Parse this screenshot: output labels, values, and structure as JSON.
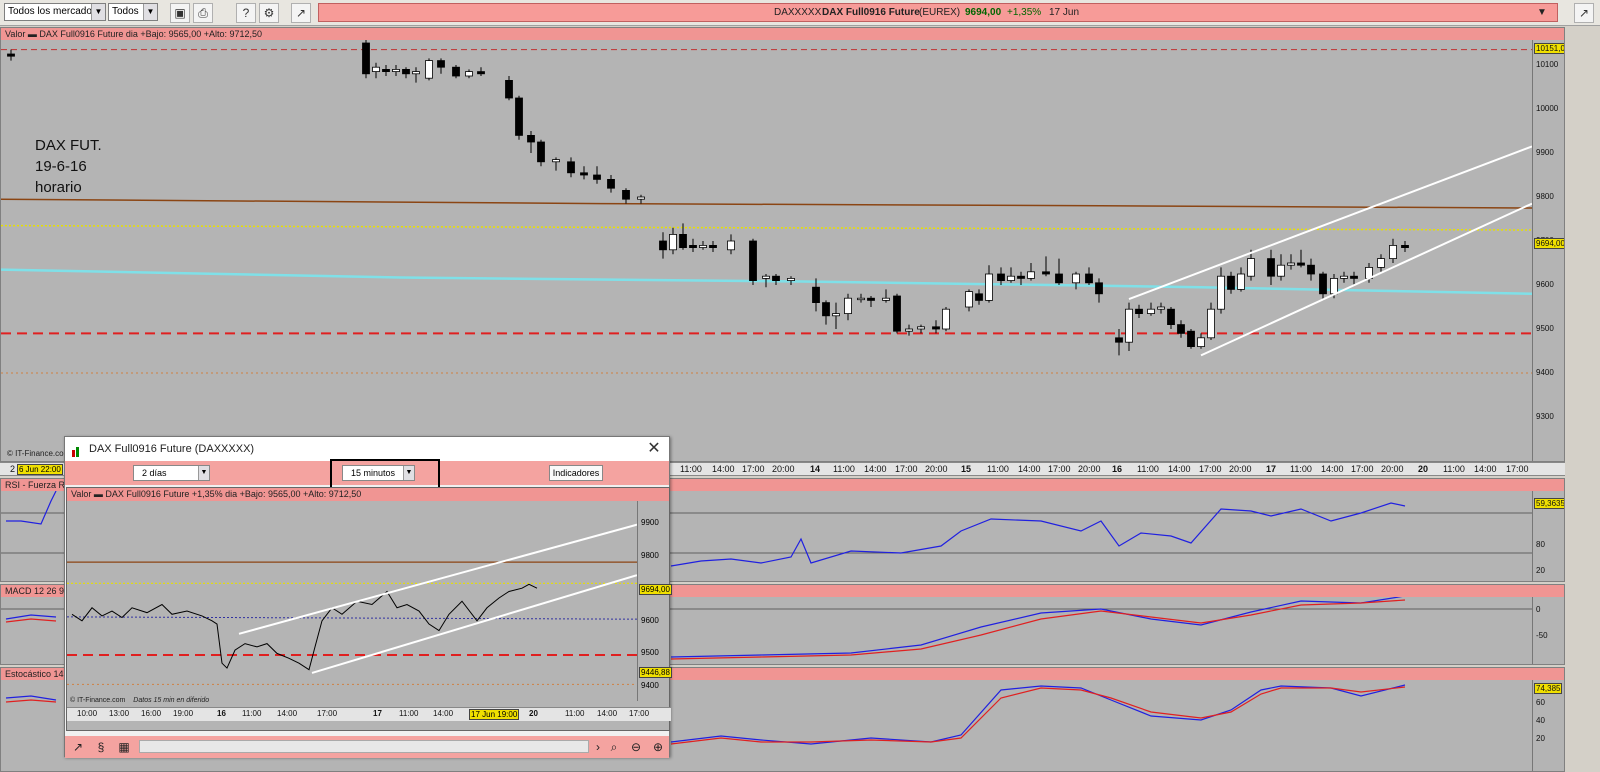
{
  "toolbar": {
    "market_select": "Todos los mercados",
    "type_select": "Todos",
    "ticker": {
      "symbol_code": "DAXXXXX",
      "name": "DAX Full0916 Future",
      "exchange": "(EUREX)",
      "price": "9694,00",
      "change": "+1,35%",
      "date": "17 Jun"
    }
  },
  "main_chart": {
    "header": "Valor  ▬ DAX Full0916 Future   dia +Bajo: 9565,00 +Alto: 9712,50",
    "source": "© IT-Finance.com",
    "annotation": [
      "DAX FUT.",
      "19-6-16",
      "horario"
    ],
    "y_labels": [
      "10100",
      "10000",
      "9900",
      "9800",
      "9700",
      "9600",
      "9500",
      "9400",
      "9300"
    ],
    "top_badge": "10151,0",
    "price_badge": "9694,00",
    "date_badge": "6 Jun 22:00",
    "date_prefix": "2",
    "time_labels": [
      "11:00",
      "14:00",
      "17:00",
      "20:00",
      "14",
      "11:00",
      "14:00",
      "17:00",
      "20:00",
      "15",
      "11:00",
      "14:00",
      "17:00",
      "20:00",
      "16",
      "11:00",
      "14:00",
      "17:00",
      "20:00",
      "17",
      "11:00",
      "14:00",
      "17:00",
      "20:00",
      "20",
      "11:00",
      "14:00",
      "17:00"
    ]
  },
  "rsi": {
    "label": "RSI - Fuerza R",
    "value_badge": "59,3635",
    "y_labels": [
      "80",
      "20"
    ]
  },
  "macd": {
    "label": "MACD 12 26 9",
    "y_labels": [
      "0",
      "-50"
    ]
  },
  "stoch": {
    "label": "Estocástico 14",
    "value_badge": "74,385",
    "y_labels": [
      "80",
      "60",
      "40",
      "20"
    ]
  },
  "popup": {
    "title": "DAX Full0916 Future (DAXXXXX)",
    "period_select": "2 días",
    "interval_select": "15 minutos",
    "indicators_button": "Indicadores",
    "header": "Valor  ▬ DAX Full0916 Future   +1,35%  dia +Bajo: 9565,00 +Alto: 9712,50",
    "source": "© IT-Finance.com",
    "delay_note": "Datos 15 min en diferido",
    "y_labels": [
      "9900",
      "9800",
      "9600",
      "9500",
      "9400"
    ],
    "price_badge": "9694,00",
    "low_badge": "9446,88",
    "date_badge": "17 Jun 19:00",
    "time_labels": [
      "10:00",
      "13:00",
      "16:00",
      "19:00",
      "16",
      "11:00",
      "14:00",
      "17:00",
      "17",
      "11:00",
      "14:00",
      "20",
      "11:00",
      "14:00",
      "17:00"
    ]
  },
  "colors": {
    "background": "#b4b4b4",
    "header": "#f09593",
    "ticker": "#f79b98",
    "bull": "#ffffff",
    "bear": "#000000",
    "ma_cyan": "#7fe0e8",
    "ma_brown": "#8b4513",
    "level_red": "#e02020",
    "rsi": "#2020e0",
    "signal": "#e02020"
  }
}
